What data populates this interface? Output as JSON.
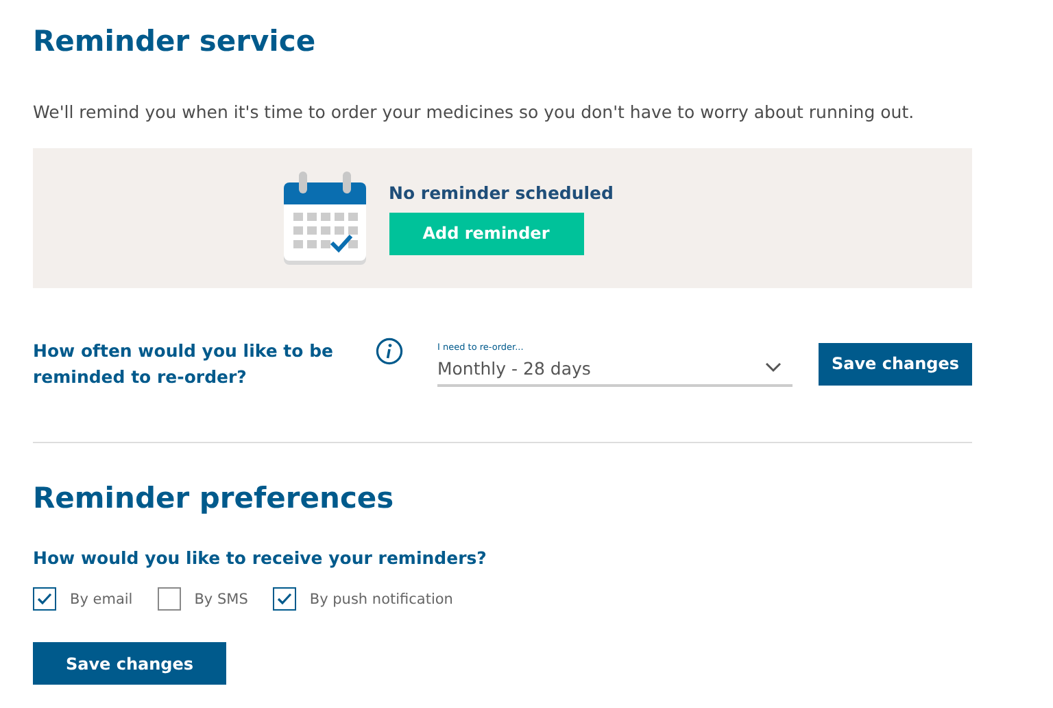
{
  "title": "Reminder service",
  "intro": "We'll remind you when it's time to order your medicines so you don't have to worry about running out.",
  "reminder_panel": {
    "status": "No reminder scheduled",
    "button": "Add reminder"
  },
  "frequency": {
    "question": "How often would you like to be reminded to re-order?",
    "field_label": "I need to re-order...",
    "value": "Monthly - 28 days",
    "button": "Save changes"
  },
  "preferences": {
    "title": "Reminder preferences",
    "question": "How would you like to receive your reminders?",
    "options": [
      {
        "label": "By email",
        "checked": true
      },
      {
        "label": "By SMS",
        "checked": false
      },
      {
        "label": "By push notification",
        "checked": true
      }
    ],
    "button": "Save changes"
  }
}
